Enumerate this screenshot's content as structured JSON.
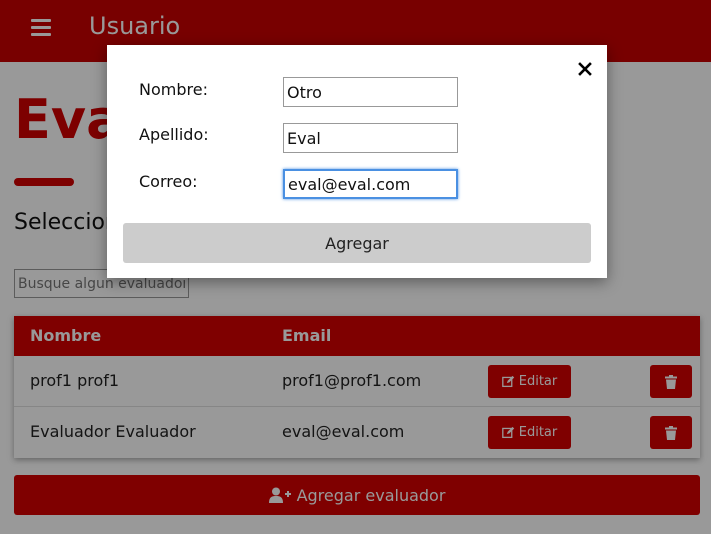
{
  "topbar": {
    "title": "Usuario",
    "menu_icon": "hamburger-menu-icon"
  },
  "page": {
    "heading": "Evaluadores",
    "section_title": "Seleccione un evaluador",
    "search": {
      "placeholder": "Busque algun evaluador",
      "value": ""
    }
  },
  "table": {
    "headers": {
      "name": "Nombre",
      "email": "Email"
    },
    "rows": [
      {
        "name": "prof1 prof1",
        "email": "prof1@prof1.com",
        "edit_label": "Editar"
      },
      {
        "name": "Evaluador Evaluador",
        "email": "eval@eval.com",
        "edit_label": "Editar"
      }
    ]
  },
  "add_button": {
    "label": "Agregar evaluador",
    "icon": "user-plus-icon"
  },
  "modal": {
    "fields": {
      "nombre": {
        "label": "Nombre:",
        "value": "Otro"
      },
      "apellido": {
        "label": "Apellido:",
        "value": "Eval"
      },
      "correo": {
        "label": "Correo:",
        "value": "eval@eval.com"
      }
    },
    "submit_label": "Agregar",
    "close_icon": "close-icon"
  },
  "colors": {
    "primary": "#d40000",
    "overlay": "rgba(0,0,0,0.4)",
    "submit_bg": "#cccccc",
    "focus": "#4a90e2"
  }
}
